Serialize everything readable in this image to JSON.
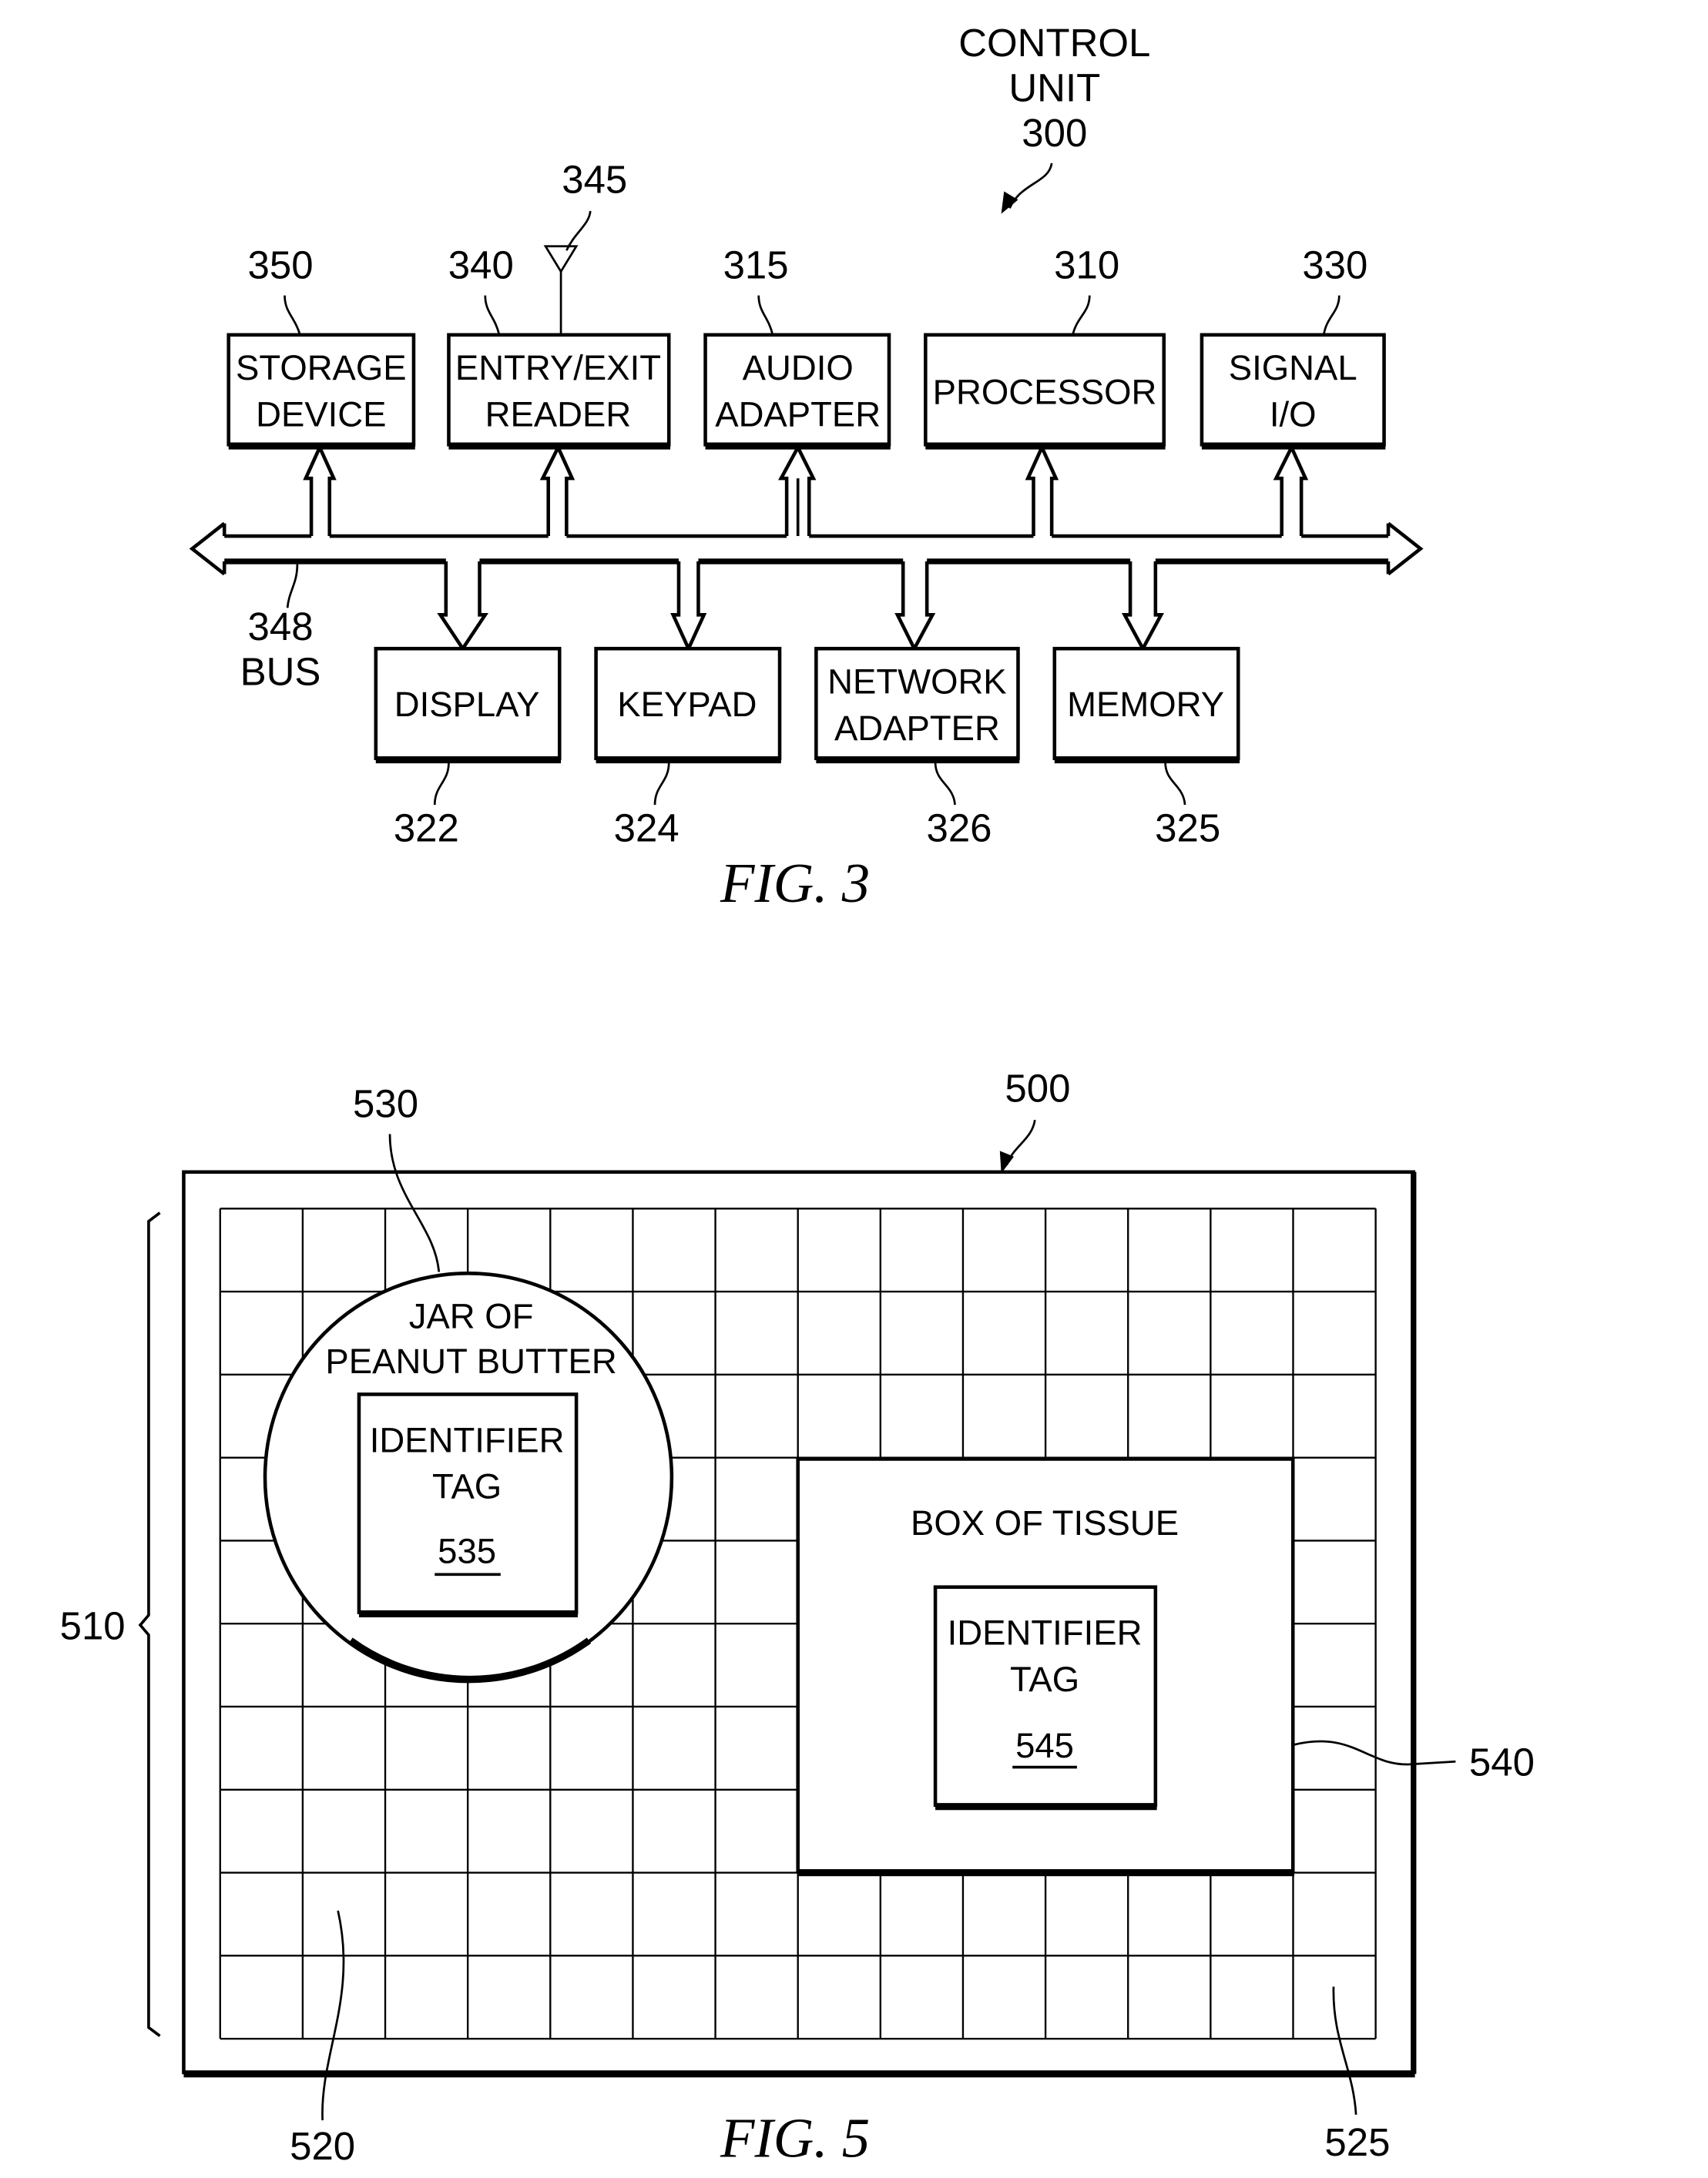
{
  "fig3": {
    "caption": "FIG. 3",
    "control_unit": {
      "line1": "CONTROL",
      "line2": "UNIT",
      "ref": "300"
    },
    "antenna_ref": "345",
    "bus": {
      "ref": "348",
      "label": "BUS"
    },
    "top_blocks": [
      {
        "ref": "350",
        "line1": "STORAGE",
        "line2": "DEVICE"
      },
      {
        "ref": "340",
        "line1": "ENTRY/EXIT",
        "line2": "READER"
      },
      {
        "ref": "315",
        "line1": "AUDIO",
        "line2": "ADAPTER"
      },
      {
        "ref": "310",
        "line1": "PROCESSOR",
        "line2": ""
      },
      {
        "ref": "330",
        "line1": "SIGNAL",
        "line2": "I/O"
      }
    ],
    "bottom_blocks": [
      {
        "ref": "322",
        "line1": "DISPLAY",
        "line2": ""
      },
      {
        "ref": "324",
        "line1": "KEYPAD",
        "line2": ""
      },
      {
        "ref": "326",
        "line1": "NETWORK",
        "line2": "ADAPTER"
      },
      {
        "ref": "325",
        "line1": "MEMORY",
        "line2": ""
      }
    ]
  },
  "fig5": {
    "caption": "FIG. 5",
    "refs": {
      "frame": "500",
      "grid_region": "510",
      "cell_left": "520",
      "cell_right": "525"
    },
    "jar": {
      "ref": "530",
      "line1": "JAR OF",
      "line2": "PEANUT BUTTER",
      "tag_line1": "IDENTIFIER",
      "tag_line2": "TAG",
      "tag_ref": "535"
    },
    "box": {
      "ref": "540",
      "label": "BOX OF TISSUE",
      "tag_line1": "IDENTIFIER",
      "tag_line2": "TAG",
      "tag_ref": "545"
    }
  }
}
